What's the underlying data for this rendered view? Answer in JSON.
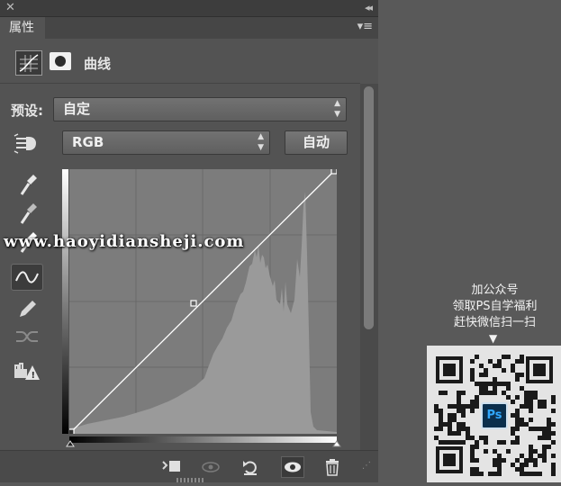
{
  "panel": {
    "close_glyph": "✕",
    "collapse_glyph": "◂◂",
    "tab_label": "属性",
    "menu_glyph": "▾≡",
    "header_title": "曲线"
  },
  "preset": {
    "label": "预设:",
    "value": "自定"
  },
  "channel": {
    "value": "RGB"
  },
  "auto_button": {
    "label": "自动"
  },
  "curve": {
    "points": [
      [
        0,
        0
      ],
      [
        128,
        128
      ],
      [
        255,
        255
      ]
    ],
    "grid_divisions": 4
  },
  "watermark": {
    "text": "www.haoyidiansheji.com"
  },
  "promo": {
    "lines": [
      "加公众号",
      "领取PS自学福利",
      "赶快微信扫一扫"
    ],
    "arrow": "▼",
    "logo_text": "Ps"
  },
  "colors": {
    "panel_bg": "#535353",
    "graph_bg": "#7c7c7c",
    "histogram": "#9a9a9a",
    "curve": "#ffffff"
  }
}
